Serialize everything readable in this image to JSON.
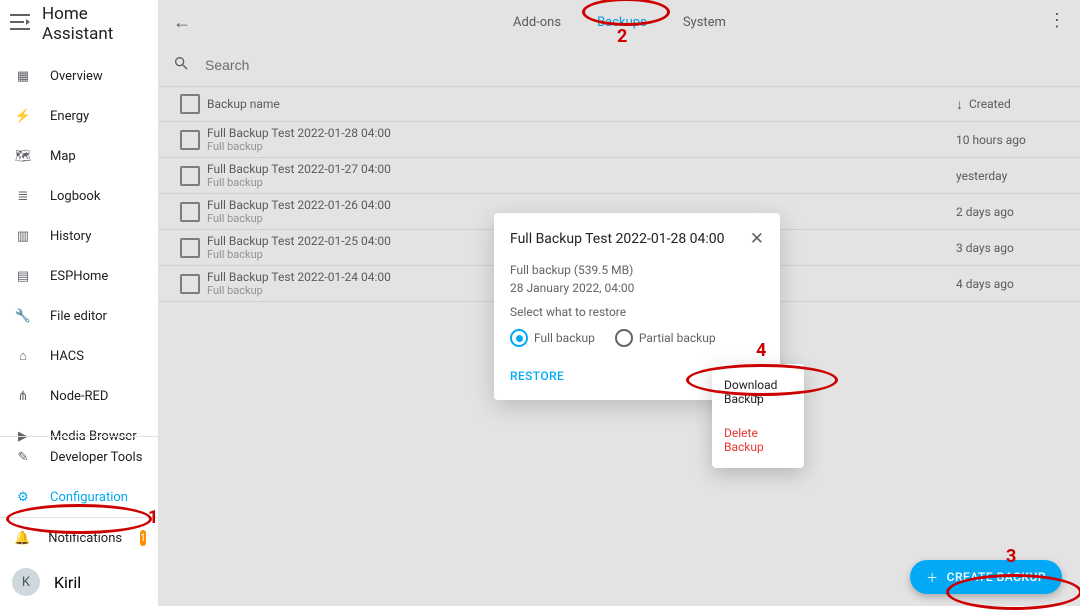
{
  "sidebar": {
    "brand": "Home Assistant",
    "items": [
      {
        "label": "Overview",
        "icon": "▦"
      },
      {
        "label": "Energy",
        "icon": "⚡"
      },
      {
        "label": "Map",
        "icon": "🗺"
      },
      {
        "label": "Logbook",
        "icon": "≣"
      },
      {
        "label": "History",
        "icon": "▥"
      },
      {
        "label": "ESPHome",
        "icon": "▤"
      },
      {
        "label": "File editor",
        "icon": "🔧"
      },
      {
        "label": "HACS",
        "icon": "⌂"
      },
      {
        "label": "Node-RED",
        "icon": "⋔"
      },
      {
        "label": "Media Browser",
        "icon": "▶"
      }
    ],
    "lower": {
      "devtools": {
        "label": "Developer Tools",
        "icon": "✎"
      },
      "config": {
        "label": "Configuration",
        "icon": "⚙",
        "selected": true
      },
      "notifications": {
        "label": "Notifications",
        "icon": "🔔",
        "badge": "1"
      }
    },
    "user": {
      "initial": "K",
      "name": "Kiril"
    }
  },
  "topbar": {
    "tabs": [
      {
        "label": "Add-ons",
        "active": false
      },
      {
        "label": "Backups",
        "active": true
      },
      {
        "label": "System",
        "active": false
      }
    ]
  },
  "search": {
    "placeholder": "Search"
  },
  "columns": {
    "name": "Backup name",
    "created": "Created"
  },
  "rows": [
    {
      "name": "Full Backup Test 2022-01-28 04:00",
      "type": "Full backup",
      "created": "10 hours ago"
    },
    {
      "name": "Full Backup Test 2022-01-27 04:00",
      "type": "Full backup",
      "created": "yesterday"
    },
    {
      "name": "Full Backup Test 2022-01-26 04:00",
      "type": "Full backup",
      "created": "2 days ago"
    },
    {
      "name": "Full Backup Test 2022-01-25 04:00",
      "type": "Full backup",
      "created": "3 days ago"
    },
    {
      "name": "Full Backup Test 2022-01-24 04:00",
      "type": "Full backup",
      "created": "4 days ago"
    }
  ],
  "dialog": {
    "title": "Full Backup Test 2022-01-28 04:00",
    "size_line": "Full backup (539.5 MB)",
    "date_line": "28 January 2022, 04:00",
    "select_text": "Select what to restore",
    "opt_full": "Full backup",
    "opt_partial": "Partial backup",
    "restore": "RESTORE"
  },
  "menu": {
    "download": "Download Backup",
    "delete": "Delete Backup"
  },
  "fab": {
    "label": "CREATE BACKUP"
  },
  "annotations": {
    "n1": "1",
    "n2": "2",
    "n3": "3",
    "n4": "4"
  }
}
